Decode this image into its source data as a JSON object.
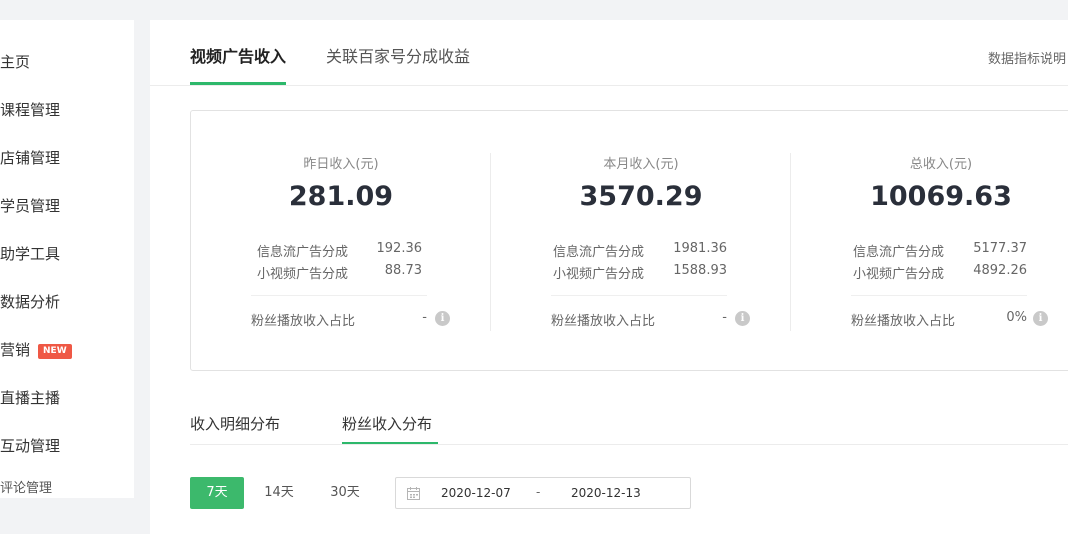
{
  "sidebar": {
    "items": [
      {
        "label": "主页"
      },
      {
        "label": "课程管理"
      },
      {
        "label": "店铺管理"
      },
      {
        "label": "学员管理"
      },
      {
        "label": "助学工具"
      },
      {
        "label": "数据分析"
      },
      {
        "label": "营销",
        "badge": "NEW"
      },
      {
        "label": "直播主播"
      },
      {
        "label": "互动管理"
      },
      {
        "label": "评论管理"
      }
    ]
  },
  "top_tabs": {
    "tabs": [
      {
        "label": "视频广告收入",
        "active": true
      },
      {
        "label": "关联百家号分成收益",
        "active": false
      }
    ],
    "help_link": "数据指标说明"
  },
  "summary": {
    "columns": [
      {
        "label": "昨日收入(元)",
        "value": "281.09",
        "details": [
          {
            "name": "信息流广告分成",
            "value": "192.36"
          },
          {
            "name": "小视频广告分成",
            "value": "88.73"
          }
        ],
        "fans_label": "粉丝播放收入占比",
        "fans_value": "-"
      },
      {
        "label": "本月收入(元)",
        "value": "3570.29",
        "details": [
          {
            "name": "信息流广告分成",
            "value": "1981.36"
          },
          {
            "name": "小视频广告分成",
            "value": "1588.93"
          }
        ],
        "fans_label": "粉丝播放收入占比",
        "fans_value": "-"
      },
      {
        "label": "总收入(元)",
        "value": "10069.63",
        "details": [
          {
            "name": "信息流广告分成",
            "value": "5177.37"
          },
          {
            "name": "小视频广告分成",
            "value": "4892.26"
          }
        ],
        "fans_label": "粉丝播放收入占比",
        "fans_value": "0%"
      }
    ],
    "info_icon_glyph": "i"
  },
  "second_tabs": {
    "tabs": [
      {
        "label": "收入明细分布",
        "active": false
      },
      {
        "label": "粉丝收入分布",
        "active": true
      }
    ]
  },
  "period": {
    "options": [
      {
        "label": "7天",
        "active": true
      },
      {
        "label": "14天",
        "active": false
      },
      {
        "label": "30天",
        "active": false
      }
    ],
    "start_date": "2020-12-07",
    "separator": "-",
    "end_date": "2020-12-13"
  },
  "colors": {
    "accent": "#2db86b",
    "badge": "#ef5845",
    "page_bg": "#f2f3f5"
  },
  "icons": {
    "calendar": "calendar-icon",
    "info": "info-icon"
  }
}
